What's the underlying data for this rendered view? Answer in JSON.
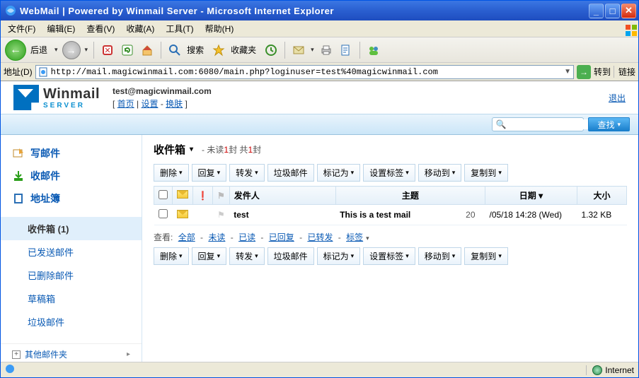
{
  "window": {
    "title": "WebMail | Powered by Winmail Server - Microsoft Internet Explorer"
  },
  "iemenu": [
    "文件(F)",
    "编辑(E)",
    "查看(V)",
    "收藏(A)",
    "工具(T)",
    "帮助(H)"
  ],
  "ietoolbar": {
    "back": "后退",
    "search": "搜索",
    "favorites": "收藏夹"
  },
  "addressbar": {
    "label": "地址(D)",
    "url": "http://mail.magicwinmail.com:6080/main.php?loginuser=test%40magicwinmail.com",
    "go": "转到",
    "links": "链接"
  },
  "header": {
    "logo_top": "Winmail",
    "logo_bottom": "SERVER",
    "email": "test@magicwinmail.com",
    "link_home": "首页",
    "link_settings": "设置",
    "link_skin": "换肤",
    "exit": "退出"
  },
  "searchbar": {
    "placeholder": "",
    "button": "查找"
  },
  "sidebar": {
    "compose": "写邮件",
    "receive": "收邮件",
    "contacts": "地址簿",
    "folders": [
      {
        "label": "收件箱 (1)",
        "active": true
      },
      {
        "label": "已发送邮件",
        "active": false
      },
      {
        "label": "已删除邮件",
        "active": false
      },
      {
        "label": "草稿箱",
        "active": false
      },
      {
        "label": "垃圾邮件",
        "active": false
      }
    ],
    "other": "其他邮件夹"
  },
  "mailbox": {
    "title": "收件箱",
    "unread_prefix": "未读",
    "unread_count": "1",
    "total_prefix": "封 共",
    "total_count": "1",
    "total_suffix": "封",
    "toolbar": [
      "删除",
      "回复",
      "转发",
      "垃圾邮件",
      "标记为",
      "设置标签",
      "移动到",
      "复制到"
    ],
    "columns": {
      "sender": "发件人",
      "subject": "主题",
      "date": "日期",
      "size": "大小"
    },
    "rows": [
      {
        "sender": "test",
        "subject": "This is a test mail",
        "count": "20",
        "date": "/05/18 14:28 (Wed)",
        "size": "1.32 KB"
      }
    ],
    "view": {
      "label": "查看:",
      "opts": [
        "全部",
        "未读",
        "已读",
        "已回复",
        "已转发",
        "标签"
      ]
    }
  },
  "statusbar": {
    "zone": "Internet"
  }
}
